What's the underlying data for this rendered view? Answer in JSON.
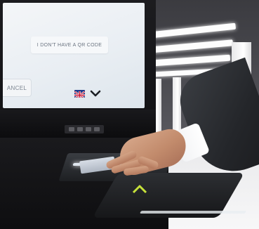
{
  "kiosk_screen": {
    "qr_button_label": "I DON'T HAVE A QR CODE",
    "cancel_button_label": "ANCEL",
    "language_flag_icon": "uk-flag-icon",
    "language_toggle_icon": "chevron-down-icon"
  },
  "colors": {
    "screen_background": "#e9eef3",
    "kiosk_body": "#141417",
    "reader_indicator": "#c7e23a"
  }
}
